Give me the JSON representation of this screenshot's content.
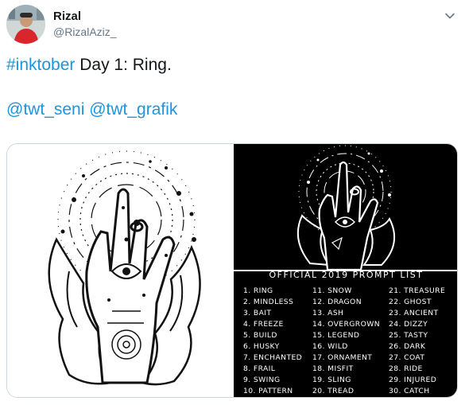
{
  "user": {
    "name": "Rizal",
    "handle": "@RizalAziz_"
  },
  "tweet": {
    "hashtag": "#inktober",
    "text": " Day 1: Ring.",
    "mention1": "@twt_seni",
    "mention2": "@twt_grafik"
  },
  "icons": {
    "more": "chevron-down-icon"
  },
  "prompt_list": {
    "title": "OFFICIAL 2019 PROMPT LIST",
    "col1": [
      "1. RING",
      "2. MINDLESS",
      "3. BAIT",
      "4. FREEZE",
      "5. BUILD",
      "6. HUSKY",
      "7. ENCHANTED",
      "8. FRAIL",
      "9. SWING",
      "10. PATTERN"
    ],
    "col2": [
      "11. SNOW",
      "12. DRAGON",
      "13. ASH",
      "14. OVERGROWN",
      "15. LEGEND",
      "16. WILD",
      "17. ORNAMENT",
      "18. MISFIT",
      "19. SLING",
      "20. TREAD"
    ],
    "col3": [
      "21. TREASURE",
      "22. GHOST",
      "23. ANCIENT",
      "24. DIZZY",
      "25. TASTY",
      "26. DARK",
      "27. COAT",
      "28. RIDE",
      "29. INJURED",
      "30. CATCH"
    ]
  },
  "colors": {
    "link": "#1b95e0",
    "handle": "#657786",
    "border": "#ccd6dd"
  }
}
